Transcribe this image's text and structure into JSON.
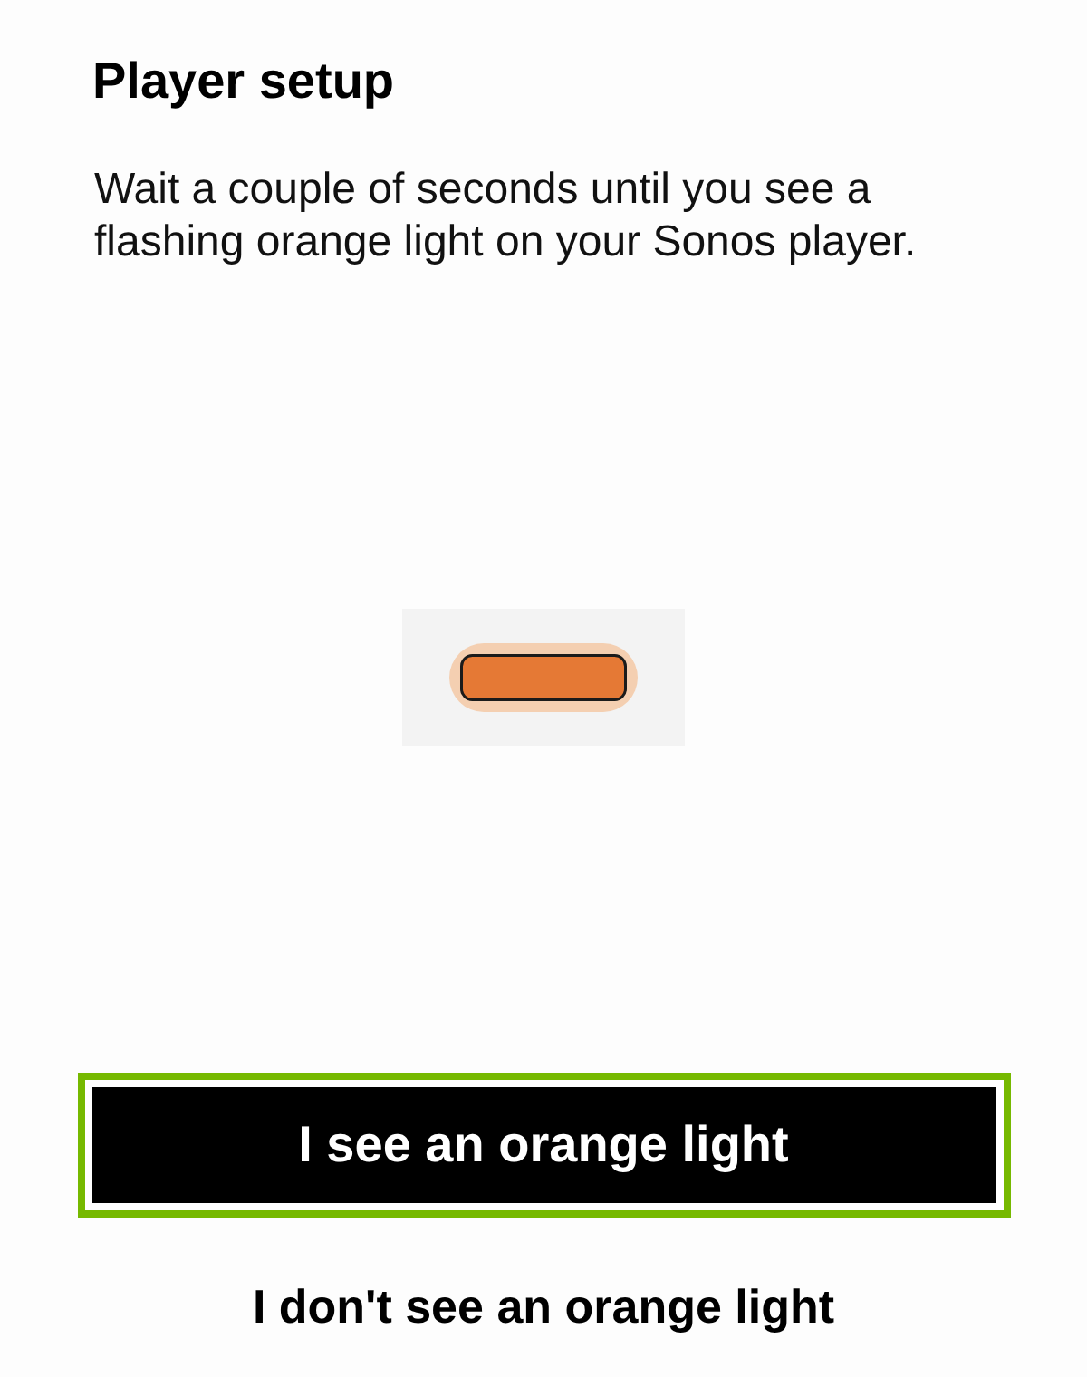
{
  "header": {
    "title": "Player setup",
    "description": "Wait a couple of seconds until you see a flashing orange light on your Sonos player."
  },
  "buttons": [
    {
      "kind": "primary",
      "label": "I see an orange light",
      "focused": true
    },
    {
      "kind": "secondary",
      "label": "I don't see an orange light",
      "focused": false
    }
  ]
}
